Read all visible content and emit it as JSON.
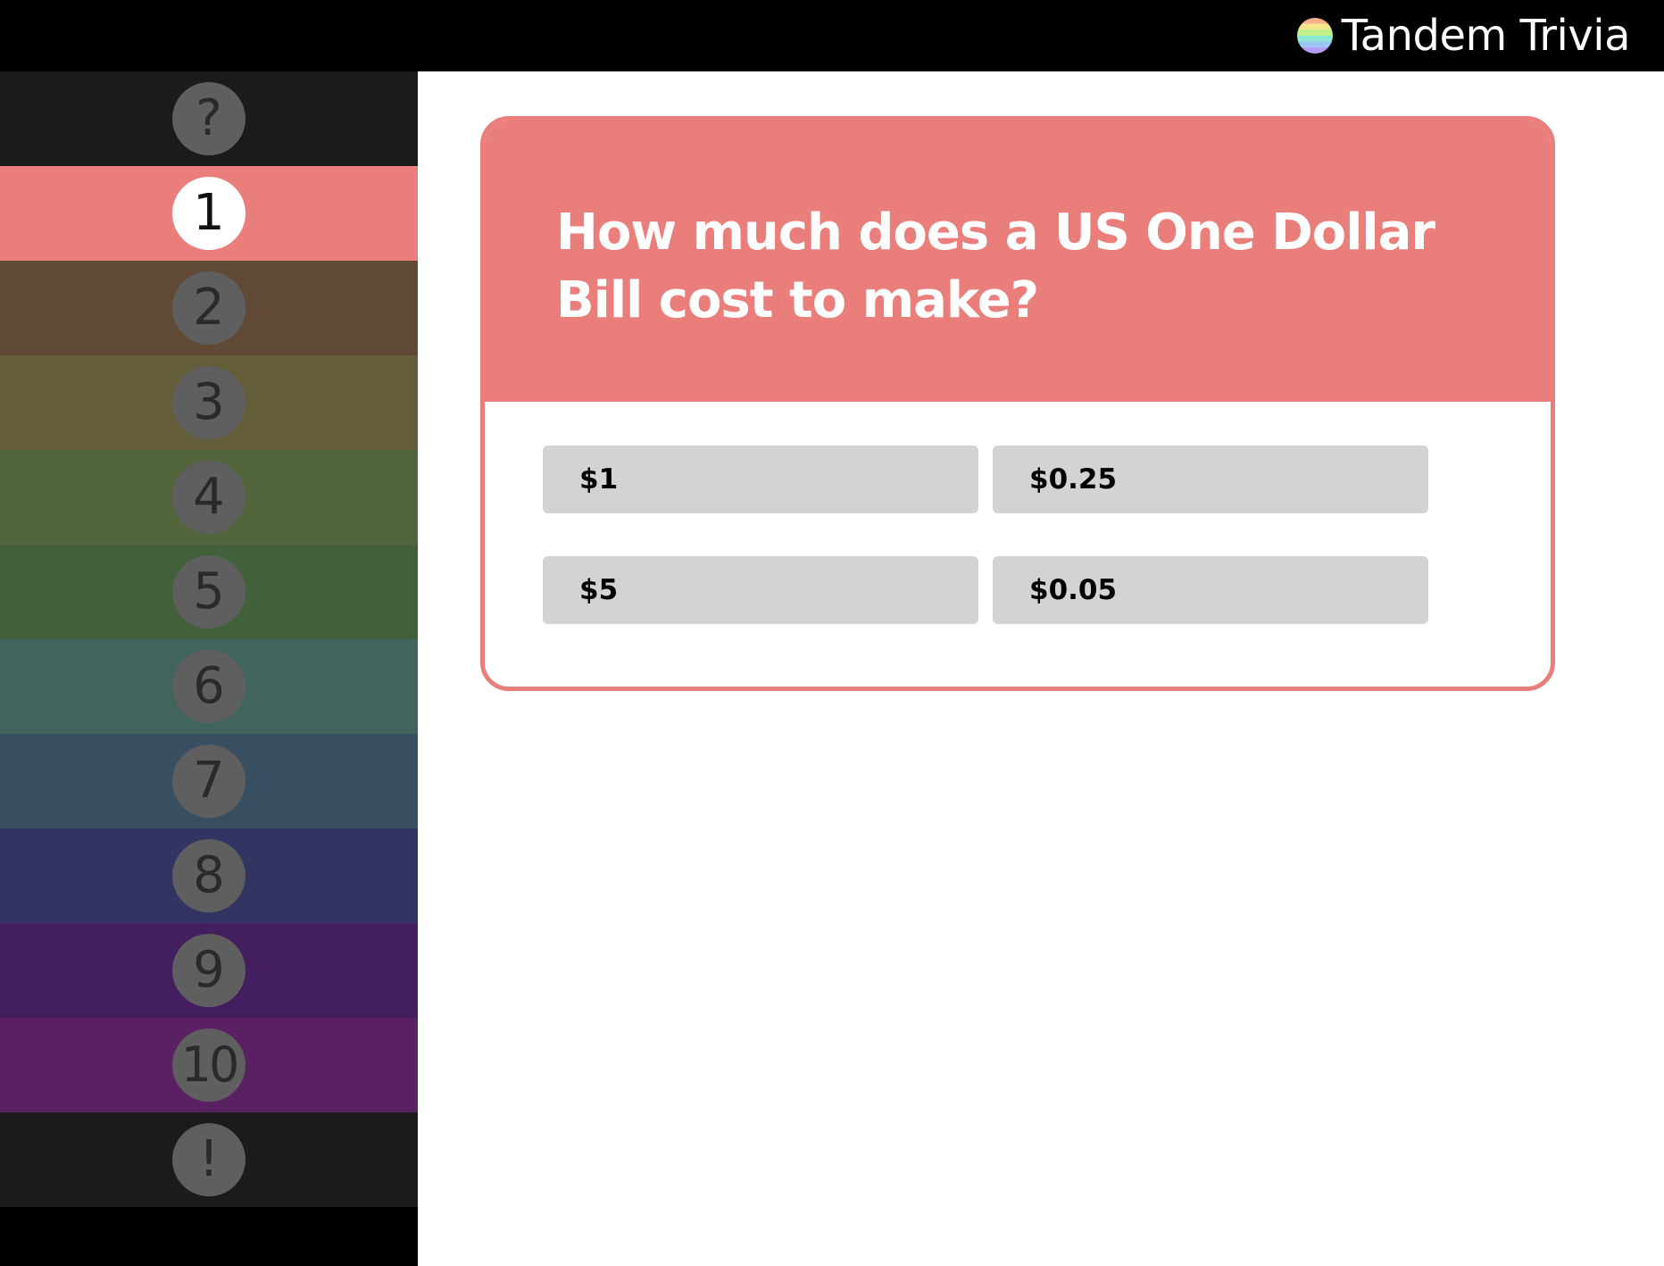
{
  "app": {
    "title": "Tandem Trivia",
    "logo_icon": "rainbow-circle-icon"
  },
  "sidebar": {
    "items": [
      {
        "label": "?",
        "color": "#1c1b1c",
        "active": false
      },
      {
        "label": "1",
        "color": "#ea7e7a",
        "active": true
      },
      {
        "label": "2",
        "color": "#604a36",
        "active": false
      },
      {
        "label": "3",
        "color": "#645d3a",
        "active": false
      },
      {
        "label": "4",
        "color": "#51643b",
        "active": false
      },
      {
        "label": "5",
        "color": "#42613b",
        "active": false
      },
      {
        "label": "6",
        "color": "#41645f",
        "active": false
      },
      {
        "label": "7",
        "color": "#384f62",
        "active": false
      },
      {
        "label": "8",
        "color": "#323462",
        "active": false
      },
      {
        "label": "9",
        "color": "#431f60",
        "active": false
      },
      {
        "label": "10",
        "color": "#5a2162",
        "active": false
      },
      {
        "label": "!",
        "color": "#1c1b1c",
        "active": false
      }
    ]
  },
  "question": {
    "text": "How much does a US One Dollar Bill cost to make?",
    "accent_color": "#ea7e7a",
    "answers": [
      "$1",
      "$0.25",
      "$5",
      "$0.05"
    ]
  }
}
